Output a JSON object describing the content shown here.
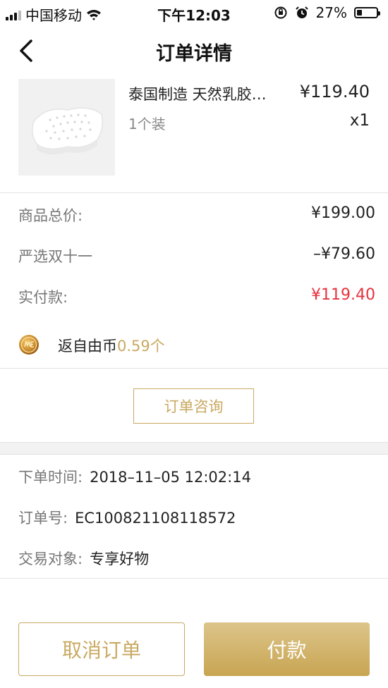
{
  "status_bar": {
    "carrier": "中国移动",
    "time": "下午12:03",
    "battery": "27%",
    "battery_level": 0.27
  },
  "nav": {
    "title": "订单详情"
  },
  "product": {
    "name": "泰国制造 天然乳胶…",
    "price": "¥119.40",
    "spec": "1个装",
    "quantity": "x1"
  },
  "summary": {
    "total_label": "商品总价:",
    "total_value": "¥199.00",
    "discount_label": "严选双十一",
    "discount_value": "–¥79.60",
    "paid_label": "实付款:",
    "paid_value": "¥119.40",
    "paid_color": "#e8323e"
  },
  "coin": {
    "prefix": "返自由币",
    "amount": "0.59个",
    "accent_color": "#c9a962"
  },
  "consult_button": "订单咨询",
  "order_info": {
    "time_label": "下单时间:",
    "time_value": "2018–11–05 12:02:14",
    "number_label": "订单号:",
    "number_value": "EC100821108118572",
    "target_label": "交易对象:",
    "target_value": "专享好物"
  },
  "actions": {
    "cancel": "取消订单",
    "pay": "付款"
  }
}
